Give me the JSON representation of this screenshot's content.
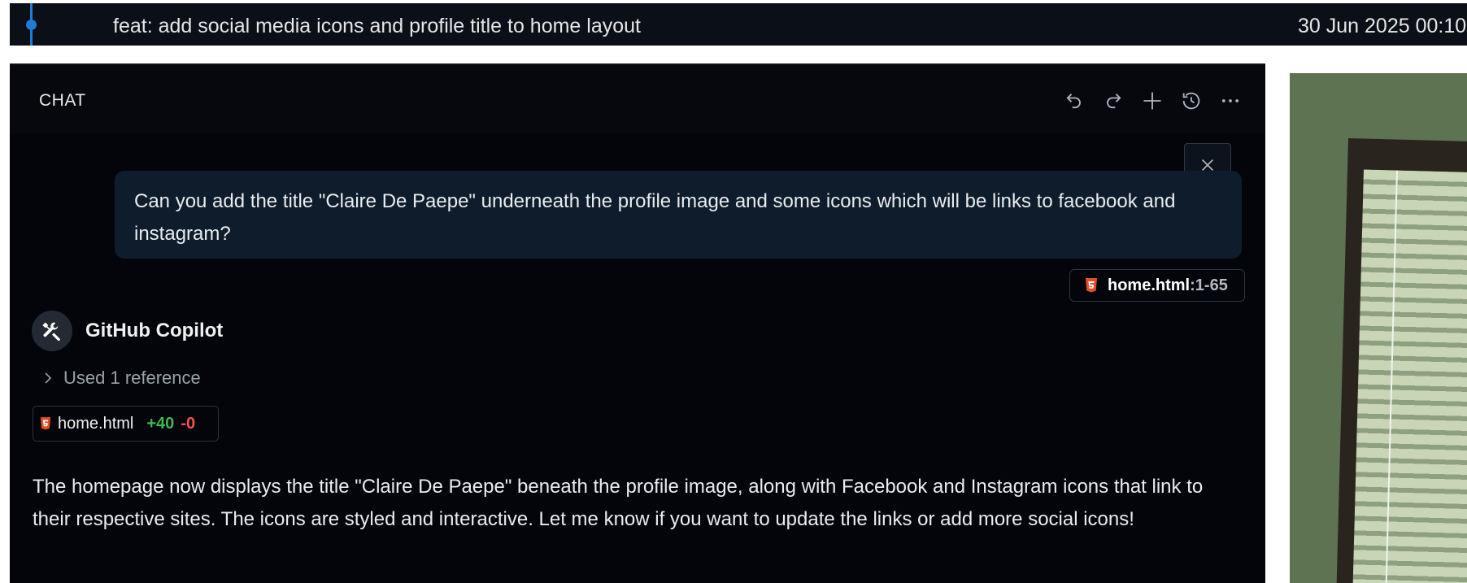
{
  "commit": {
    "message": "feat: add social media icons and profile title to home layout",
    "date": "30 Jun 2025 00:10"
  },
  "chat": {
    "title": "CHAT",
    "toolbar": [
      {
        "name": "undo",
        "icon": "undo-icon"
      },
      {
        "name": "redo",
        "icon": "redo-icon"
      },
      {
        "name": "new-chat",
        "icon": "plus-icon"
      },
      {
        "name": "history",
        "icon": "history-icon"
      },
      {
        "name": "more",
        "icon": "ellipsis-icon"
      }
    ],
    "user_message": "Can you add the title \"Claire De Paepe\" underneath the profile image and some icons which will be links to facebook and instagram?",
    "reference_chip": {
      "file": "home.html",
      "range": ":1-65"
    },
    "bot": {
      "name": "GitHub Copilot",
      "references_label": "Used 1 reference",
      "file_change": {
        "file": "home.html",
        "added": "+40",
        "removed": "-0"
      },
      "response": "The homepage now displays the title \"Claire De Paepe\" beneath the profile image, along with Facebook and Instagram icons that link to their respective sites. The icons are styled and interactive. Let me know if you want to update the links or add more social icons!"
    }
  },
  "colors": {
    "accent": "#1f7ad8",
    "added": "#3fb950",
    "removed": "#f85149",
    "html5": "#e44d26"
  }
}
